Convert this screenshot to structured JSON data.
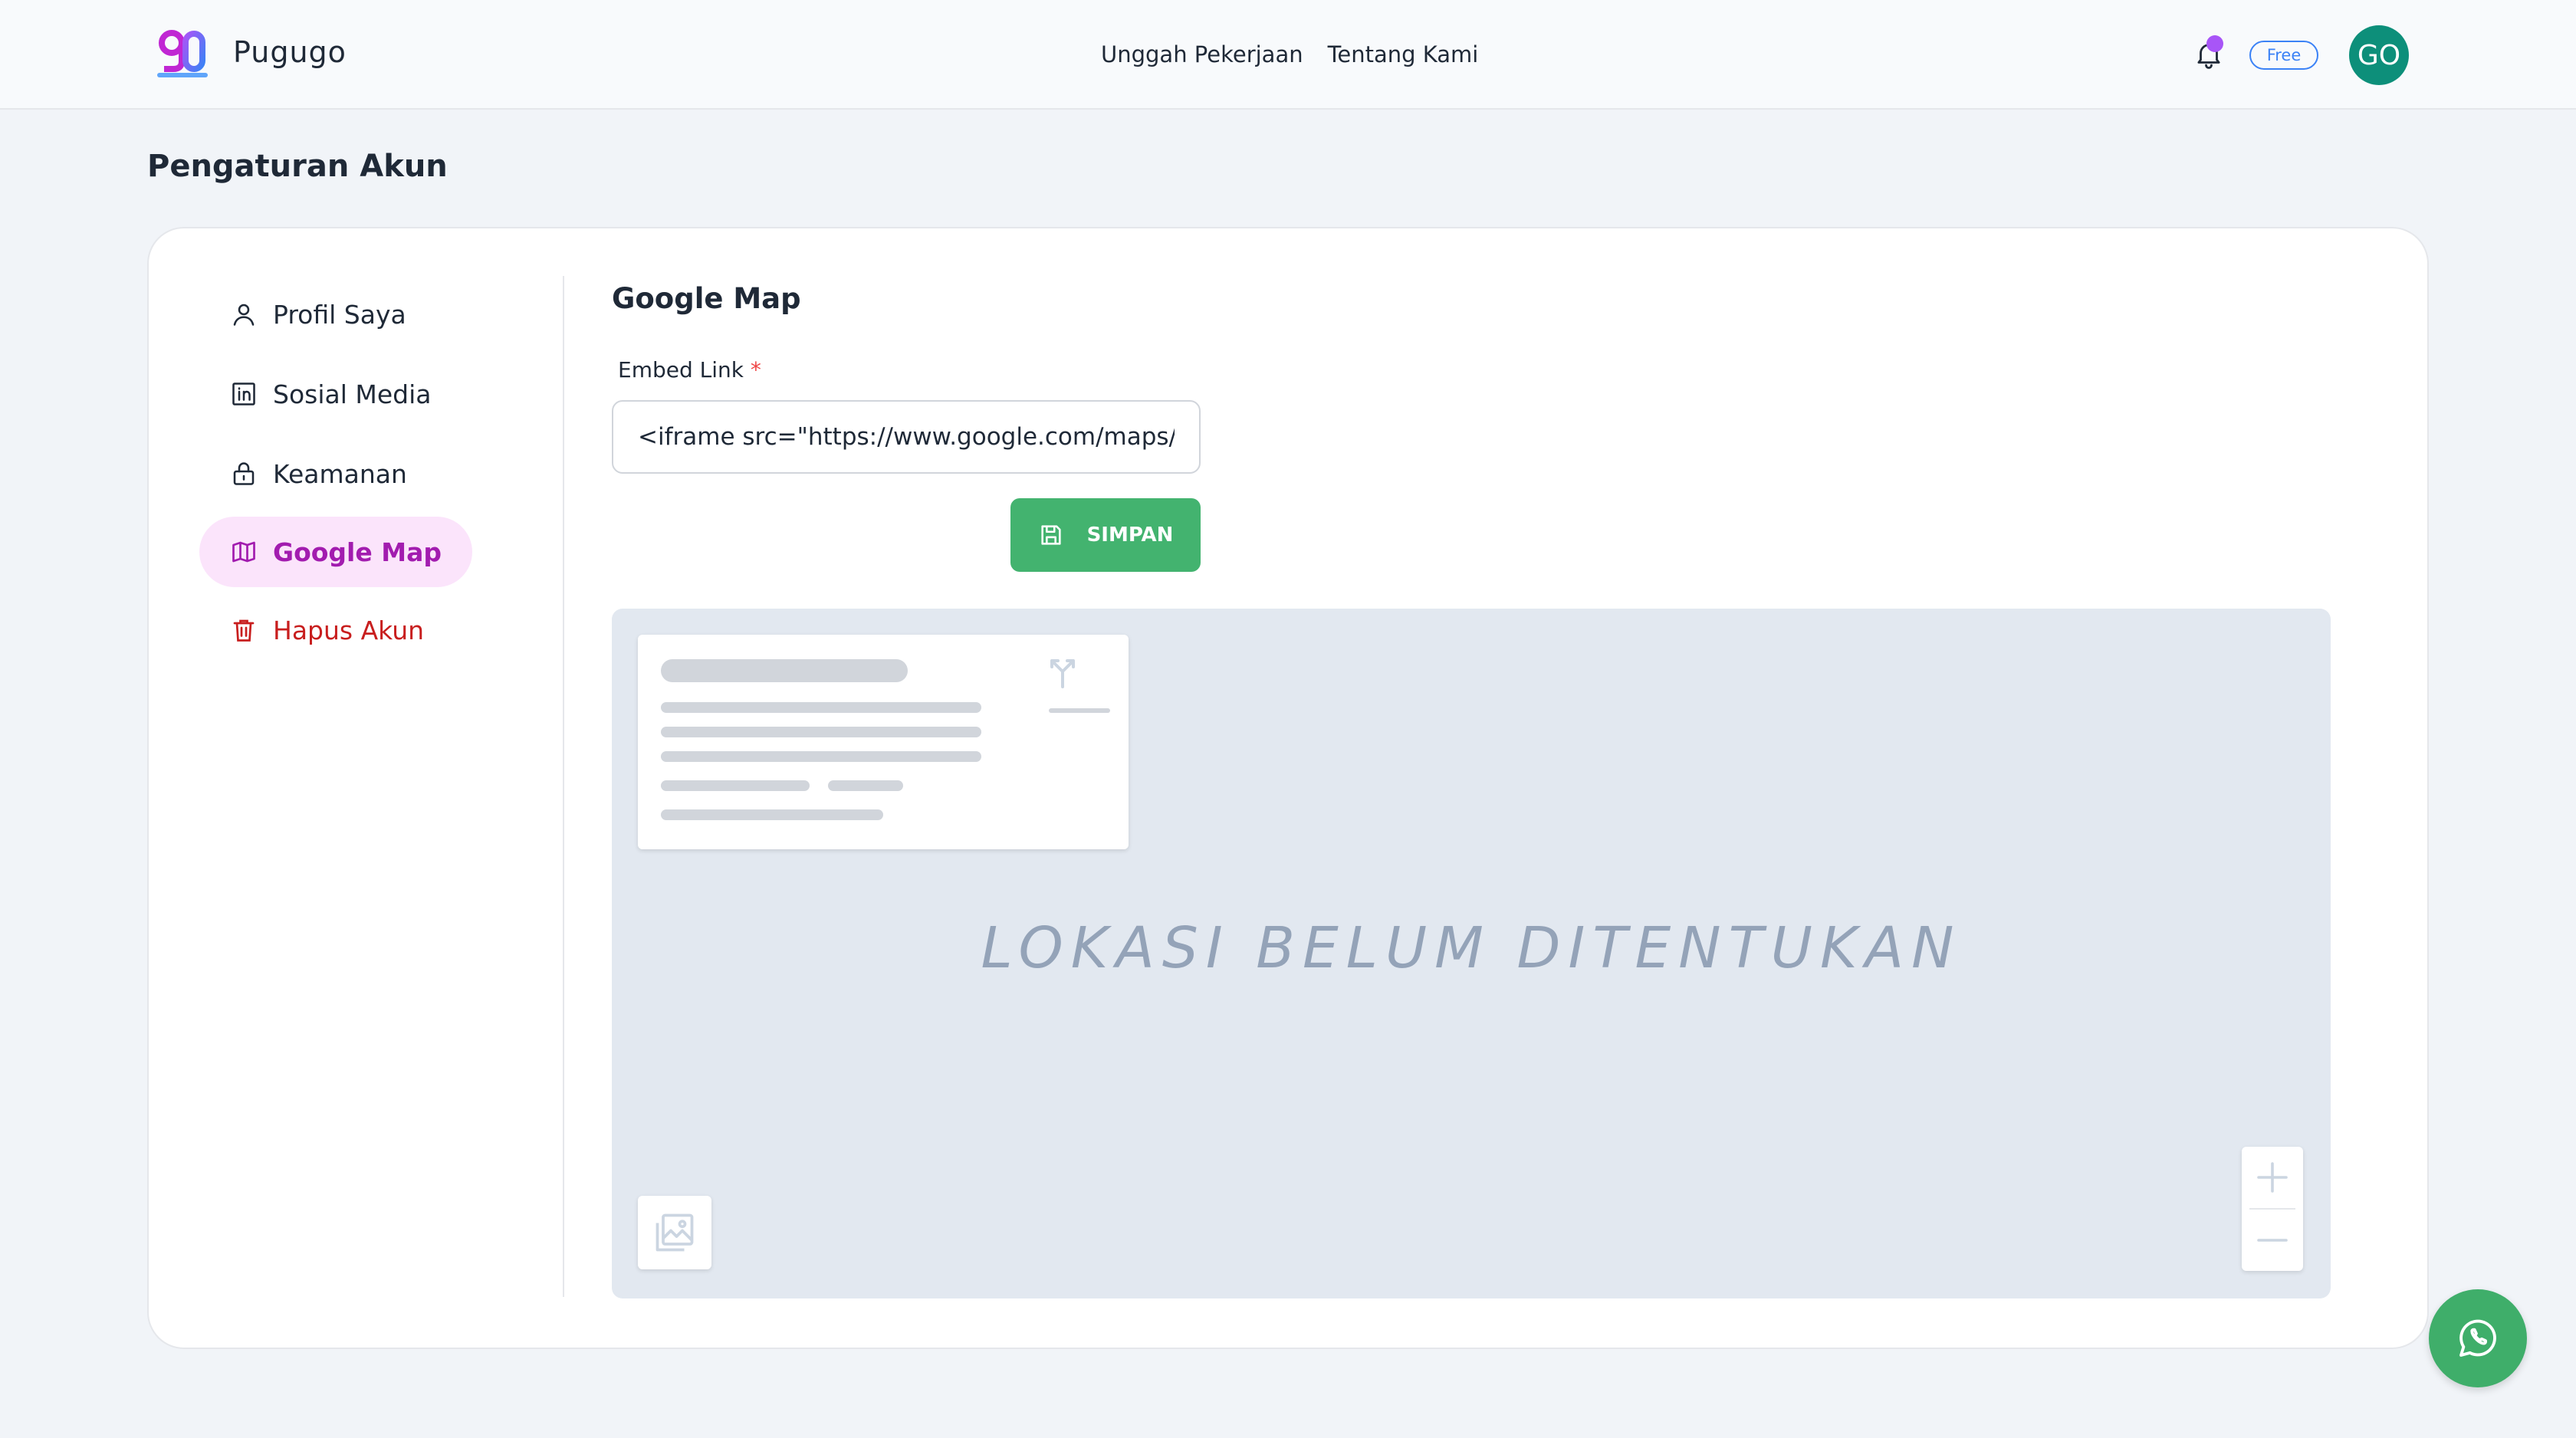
{
  "header": {
    "brand": "Pugugo",
    "nav": [
      "Unggah Pekerjaan",
      "Tentang Kami"
    ],
    "plan_badge": "Free",
    "avatar_initials": "GO",
    "notification_dot_color": "#a855f7"
  },
  "page": {
    "title": "Pengaturan Akun"
  },
  "sidebar": {
    "items": [
      {
        "label": "Profil Saya",
        "icon": "user-icon"
      },
      {
        "label": "Sosial Media",
        "icon": "linkedin-icon"
      },
      {
        "label": "Keamanan",
        "icon": "lock-icon"
      },
      {
        "label": "Google Map",
        "icon": "map-icon",
        "active": true
      },
      {
        "label": "Hapus Akun",
        "icon": "trash-icon",
        "danger": true
      }
    ]
  },
  "google_map": {
    "section_title": "Google Map",
    "embed_label": "Embed Link",
    "required_mark": "*",
    "embed_value": "<iframe src=\"https://www.google.com/maps/embed",
    "save_label": "SIMPAN",
    "empty_state": "LOKASI BELUM DITENTUKAN"
  },
  "colors": {
    "accent": "#a21caf",
    "primary_button": "#43b36f",
    "danger": "#c81e1e",
    "avatar_bg": "#0d8f7a"
  }
}
